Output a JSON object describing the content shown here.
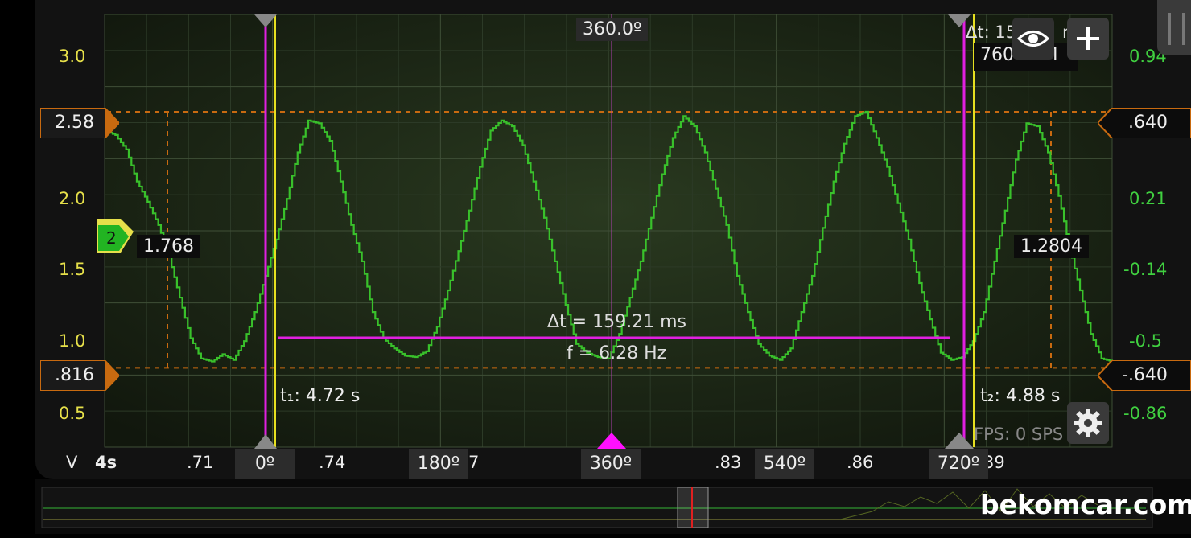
{
  "chart_data": {
    "type": "line",
    "title": "",
    "x_axis": {
      "label": "4s",
      "tick_labels": [
        ".71",
        ".74",
        "7",
        ".83",
        ".86",
        "39"
      ]
    },
    "y_left": {
      "label": "V",
      "ticks": [
        "3.0",
        "2.0",
        "1.5",
        "1.0",
        "0.5"
      ],
      "range": [
        0.27,
        3.25
      ]
    },
    "y_right": {
      "ticks": [
        "0.94",
        "0.21",
        "-0.14",
        "-0.5",
        "-0.86"
      ]
    },
    "series": [
      {
        "color": "#39c12b",
        "x": [
          0.7,
          0.7025,
          0.705,
          0.7075,
          0.71,
          0.7125,
          0.715,
          0.7175,
          0.72,
          0.7225,
          0.725,
          0.7275,
          0.73,
          0.7325,
          0.735,
          0.7375,
          0.74,
          0.7425,
          0.745,
          0.7475,
          0.75,
          0.7525,
          0.755,
          0.7575,
          0.76,
          0.7625,
          0.765,
          0.7675,
          0.77,
          0.7725,
          0.775,
          0.7775,
          0.78,
          0.7825,
          0.785,
          0.7875,
          0.79,
          0.7925,
          0.795,
          0.7975,
          0.8,
          0.8025,
          0.805,
          0.8075,
          0.81,
          0.8125,
          0.815,
          0.8175,
          0.82,
          0.8225,
          0.825,
          0.8275,
          0.83,
          0.8325,
          0.835,
          0.8375,
          0.84,
          0.8425,
          0.845,
          0.8475,
          0.85,
          0.8525,
          0.855,
          0.8575,
          0.86,
          0.8625,
          0.865,
          0.8675,
          0.87,
          0.8725,
          0.875,
          0.8775,
          0.88,
          0.8825,
          0.885,
          0.8875,
          0.89,
          0.8925,
          0.895,
          0.8975,
          0.9,
          0.9025,
          0.905,
          0.9075,
          0.91,
          0.9125,
          0.915,
          0.9175,
          0.92,
          0.9225,
          0.925,
          0.9275,
          0.93,
          0.9325,
          0.935
        ],
        "y": [
          2.45,
          2.42,
          2.32,
          2.1,
          1.96,
          1.8,
          1.58,
          1.3,
          1.02,
          0.88,
          0.86,
          0.91,
          0.87,
          1.0,
          1.2,
          1.45,
          1.7,
          1.98,
          2.3,
          2.52,
          2.5,
          2.38,
          2.1,
          1.8,
          1.55,
          1.2,
          1.02,
          0.95,
          0.9,
          0.89,
          0.93,
          1.1,
          1.35,
          1.62,
          1.9,
          2.2,
          2.45,
          2.52,
          2.48,
          2.35,
          2.1,
          1.85,
          1.55,
          1.25,
          0.98,
          0.92,
          0.89,
          0.88,
          1.05,
          1.3,
          1.55,
          1.85,
          2.15,
          2.4,
          2.55,
          2.48,
          2.3,
          2.05,
          1.8,
          1.45,
          1.2,
          0.98,
          0.9,
          0.87,
          0.95,
          1.2,
          1.45,
          1.78,
          2.1,
          2.36,
          2.55,
          2.58,
          2.4,
          2.2,
          1.95,
          1.7,
          1.4,
          1.15,
          0.92,
          0.87,
          0.89,
          1.0,
          1.2,
          1.55,
          1.9,
          2.25,
          2.5,
          2.48,
          2.3,
          2.0,
          1.65,
          1.35,
          1.05,
          0.88,
          0.86
        ]
      }
    ],
    "annotations": {
      "cursor_readout_left": "1.768",
      "cursor_readout_right": "1.2804",
      "trigger_channel": "2",
      "level_hi_left": "2.58",
      "level_lo_left": ".816",
      "level_hi_right": ".640",
      "level_lo_right": "-.640",
      "t1": "t₁: 4.72 s",
      "t2": "t₂: 4.88 s",
      "delta_t": "Δt = 159.21 ms",
      "freq": "f = 6.28 Hz",
      "center_angle": "360.0º",
      "angle_markers": [
        "0º",
        "180º",
        "360º",
        "540º",
        "720º"
      ],
      "top_right_dt": "Δt: 15",
      "top_right_dt_suffix": "r",
      "rpm": "760 RPM",
      "fps": "FPS: 0  SPS",
      "watermark": "bekomcar.com"
    }
  }
}
